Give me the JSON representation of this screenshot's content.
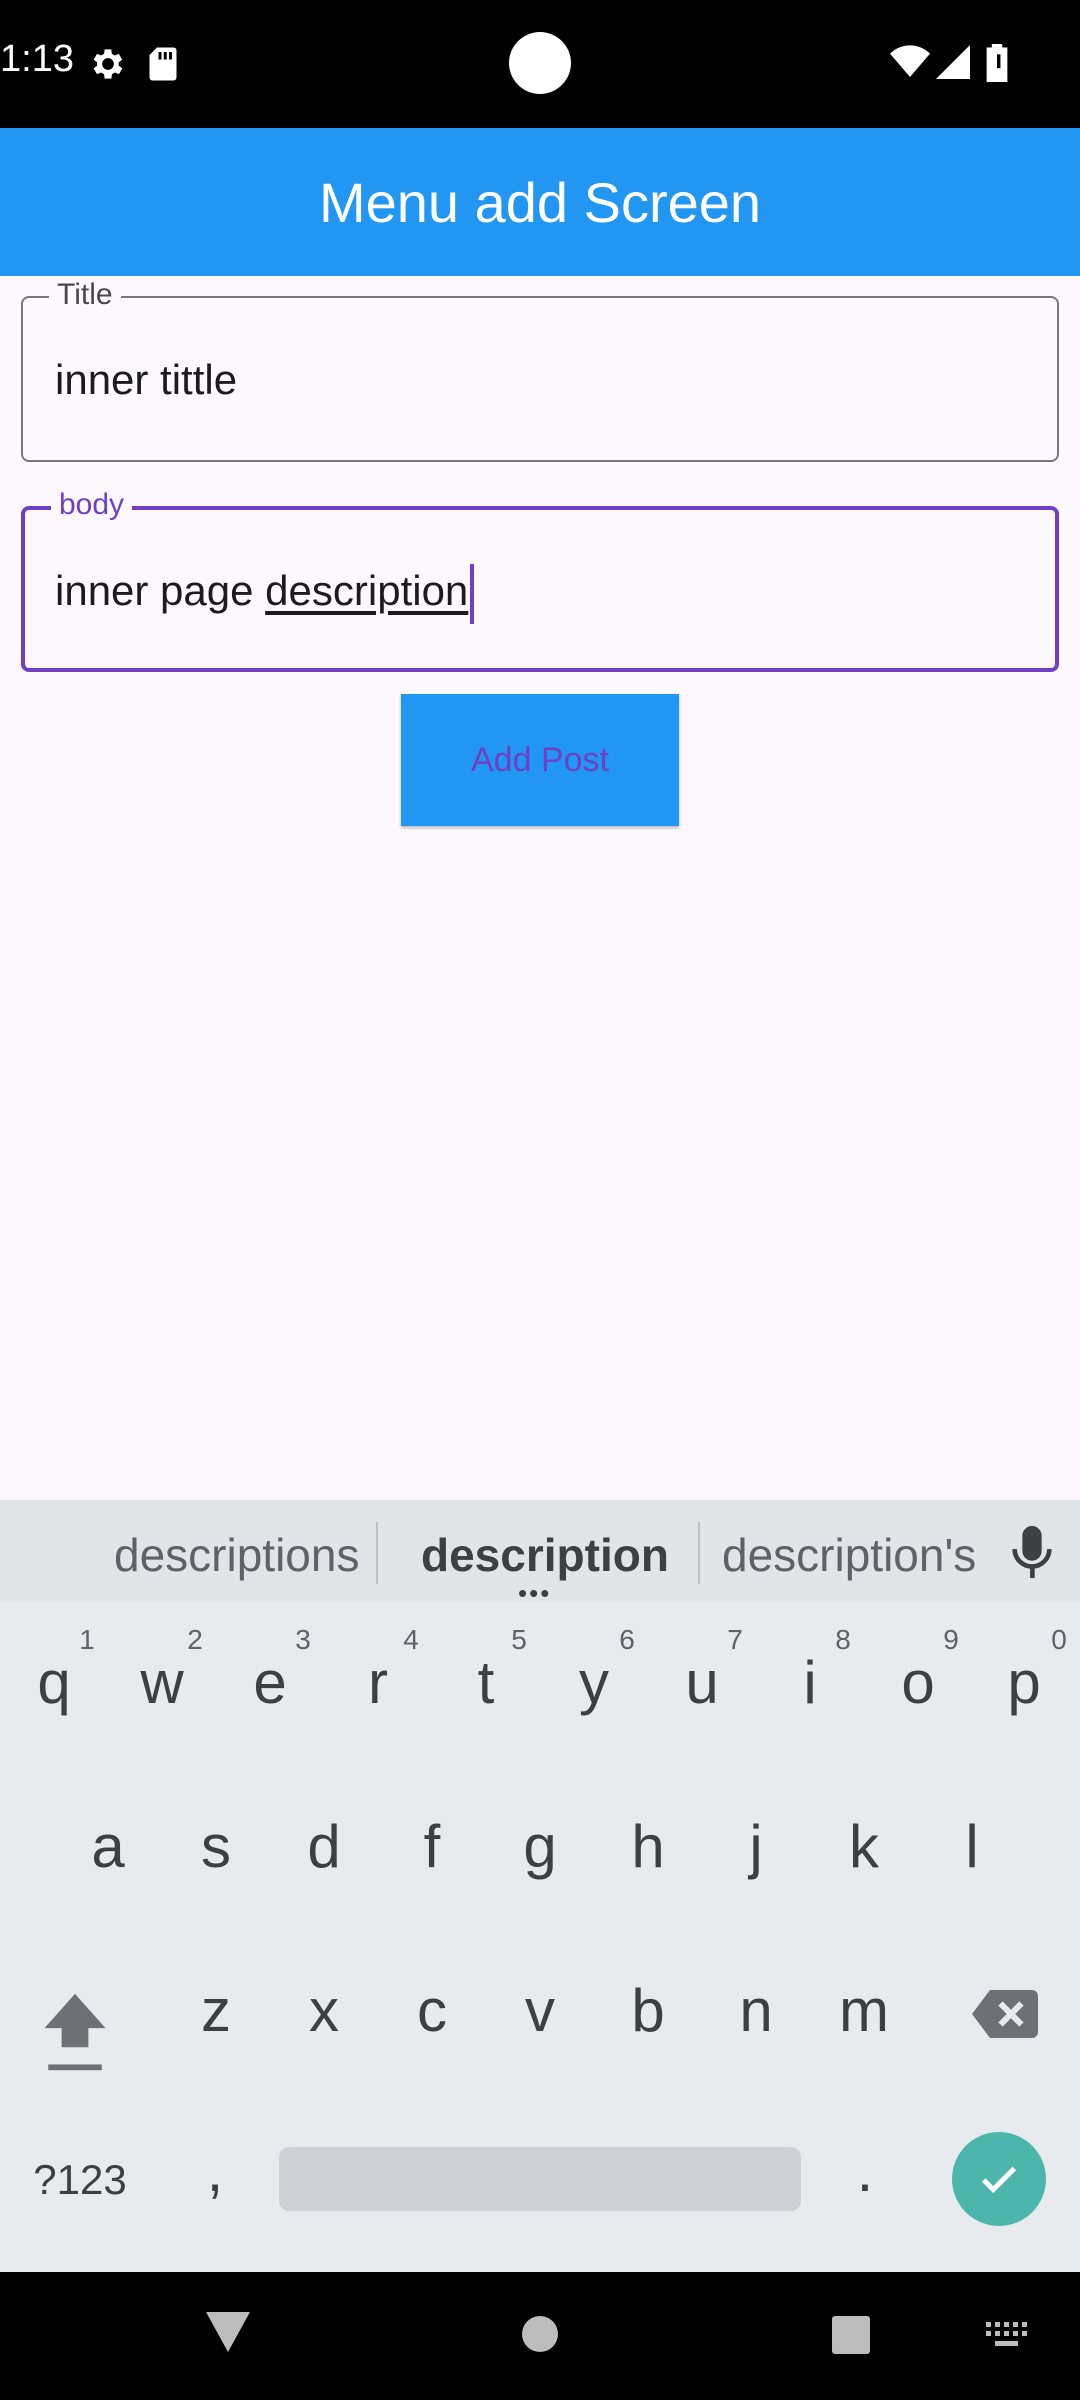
{
  "status_bar": {
    "time": "1:13",
    "icons": [
      "settings-gear-icon",
      "sd-card-icon",
      "camera-cutout",
      "wifi-icon",
      "cell-signal-icon",
      "battery-icon"
    ]
  },
  "app_bar": {
    "title": "Menu add Screen",
    "color": "#2196f3"
  },
  "form": {
    "title_field": {
      "label": "Title",
      "value": "inner tittle"
    },
    "body_field": {
      "label": "body",
      "value_plain": "inner page ",
      "value_composing": "description",
      "focused": true
    },
    "submit_label": "Add Post",
    "accent_color": "#6f3fc5"
  },
  "keyboard": {
    "suggestions": [
      "descriptions",
      "description",
      "description's"
    ],
    "row1": [
      "q",
      "w",
      "e",
      "r",
      "t",
      "y",
      "u",
      "i",
      "o",
      "p"
    ],
    "row1_hints": [
      "1",
      "2",
      "3",
      "4",
      "5",
      "6",
      "7",
      "8",
      "9",
      "0"
    ],
    "row2": [
      "a",
      "s",
      "d",
      "f",
      "g",
      "h",
      "j",
      "k",
      "l"
    ],
    "row3": [
      "z",
      "x",
      "c",
      "v",
      "b",
      "n",
      "m"
    ],
    "symbols_label": "?123",
    "comma": ",",
    "period": ".",
    "enter_color": "#4db6ac"
  },
  "nav_bar": {
    "icons": [
      "back-icon",
      "home-icon",
      "recents-icon",
      "keyboard-switch-icon"
    ]
  }
}
